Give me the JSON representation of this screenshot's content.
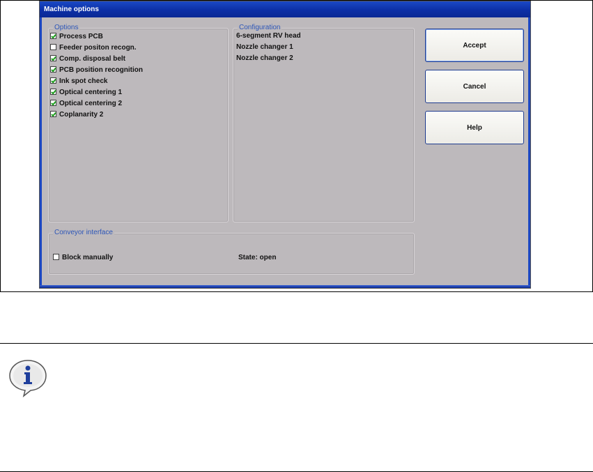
{
  "window": {
    "title": "Machine options"
  },
  "options": {
    "legend": "Options",
    "items": [
      {
        "label": "Process PCB",
        "checked": true
      },
      {
        "label": "Feeder positon recogn.",
        "checked": false
      },
      {
        "label": "Comp. disposal belt",
        "checked": true
      },
      {
        "label": "PCB position recognition",
        "checked": true
      },
      {
        "label": "Ink spot check",
        "checked": true
      },
      {
        "label": "Optical centering 1",
        "checked": true
      },
      {
        "label": "Optical centering 2",
        "checked": true
      },
      {
        "label": "Coplanarity 2",
        "checked": true
      }
    ]
  },
  "configuration": {
    "legend": "Configuration",
    "items": [
      "6-segment RV head",
      "Nozzle changer 1",
      "Nozzle changer 2"
    ]
  },
  "conveyor": {
    "legend": "Conveyor interface",
    "block_label": "Block manually",
    "block_checked": false,
    "state_text": "State: open"
  },
  "buttons": {
    "accept": "Accept",
    "cancel": "Cancel",
    "help": "Help"
  },
  "icons": {
    "info": "info-icon"
  },
  "colors": {
    "titlebar": "#0c2fa6",
    "dialog_bg": "#bdb9bc",
    "legend_text": "#2d56b8",
    "check": "#20a020"
  }
}
